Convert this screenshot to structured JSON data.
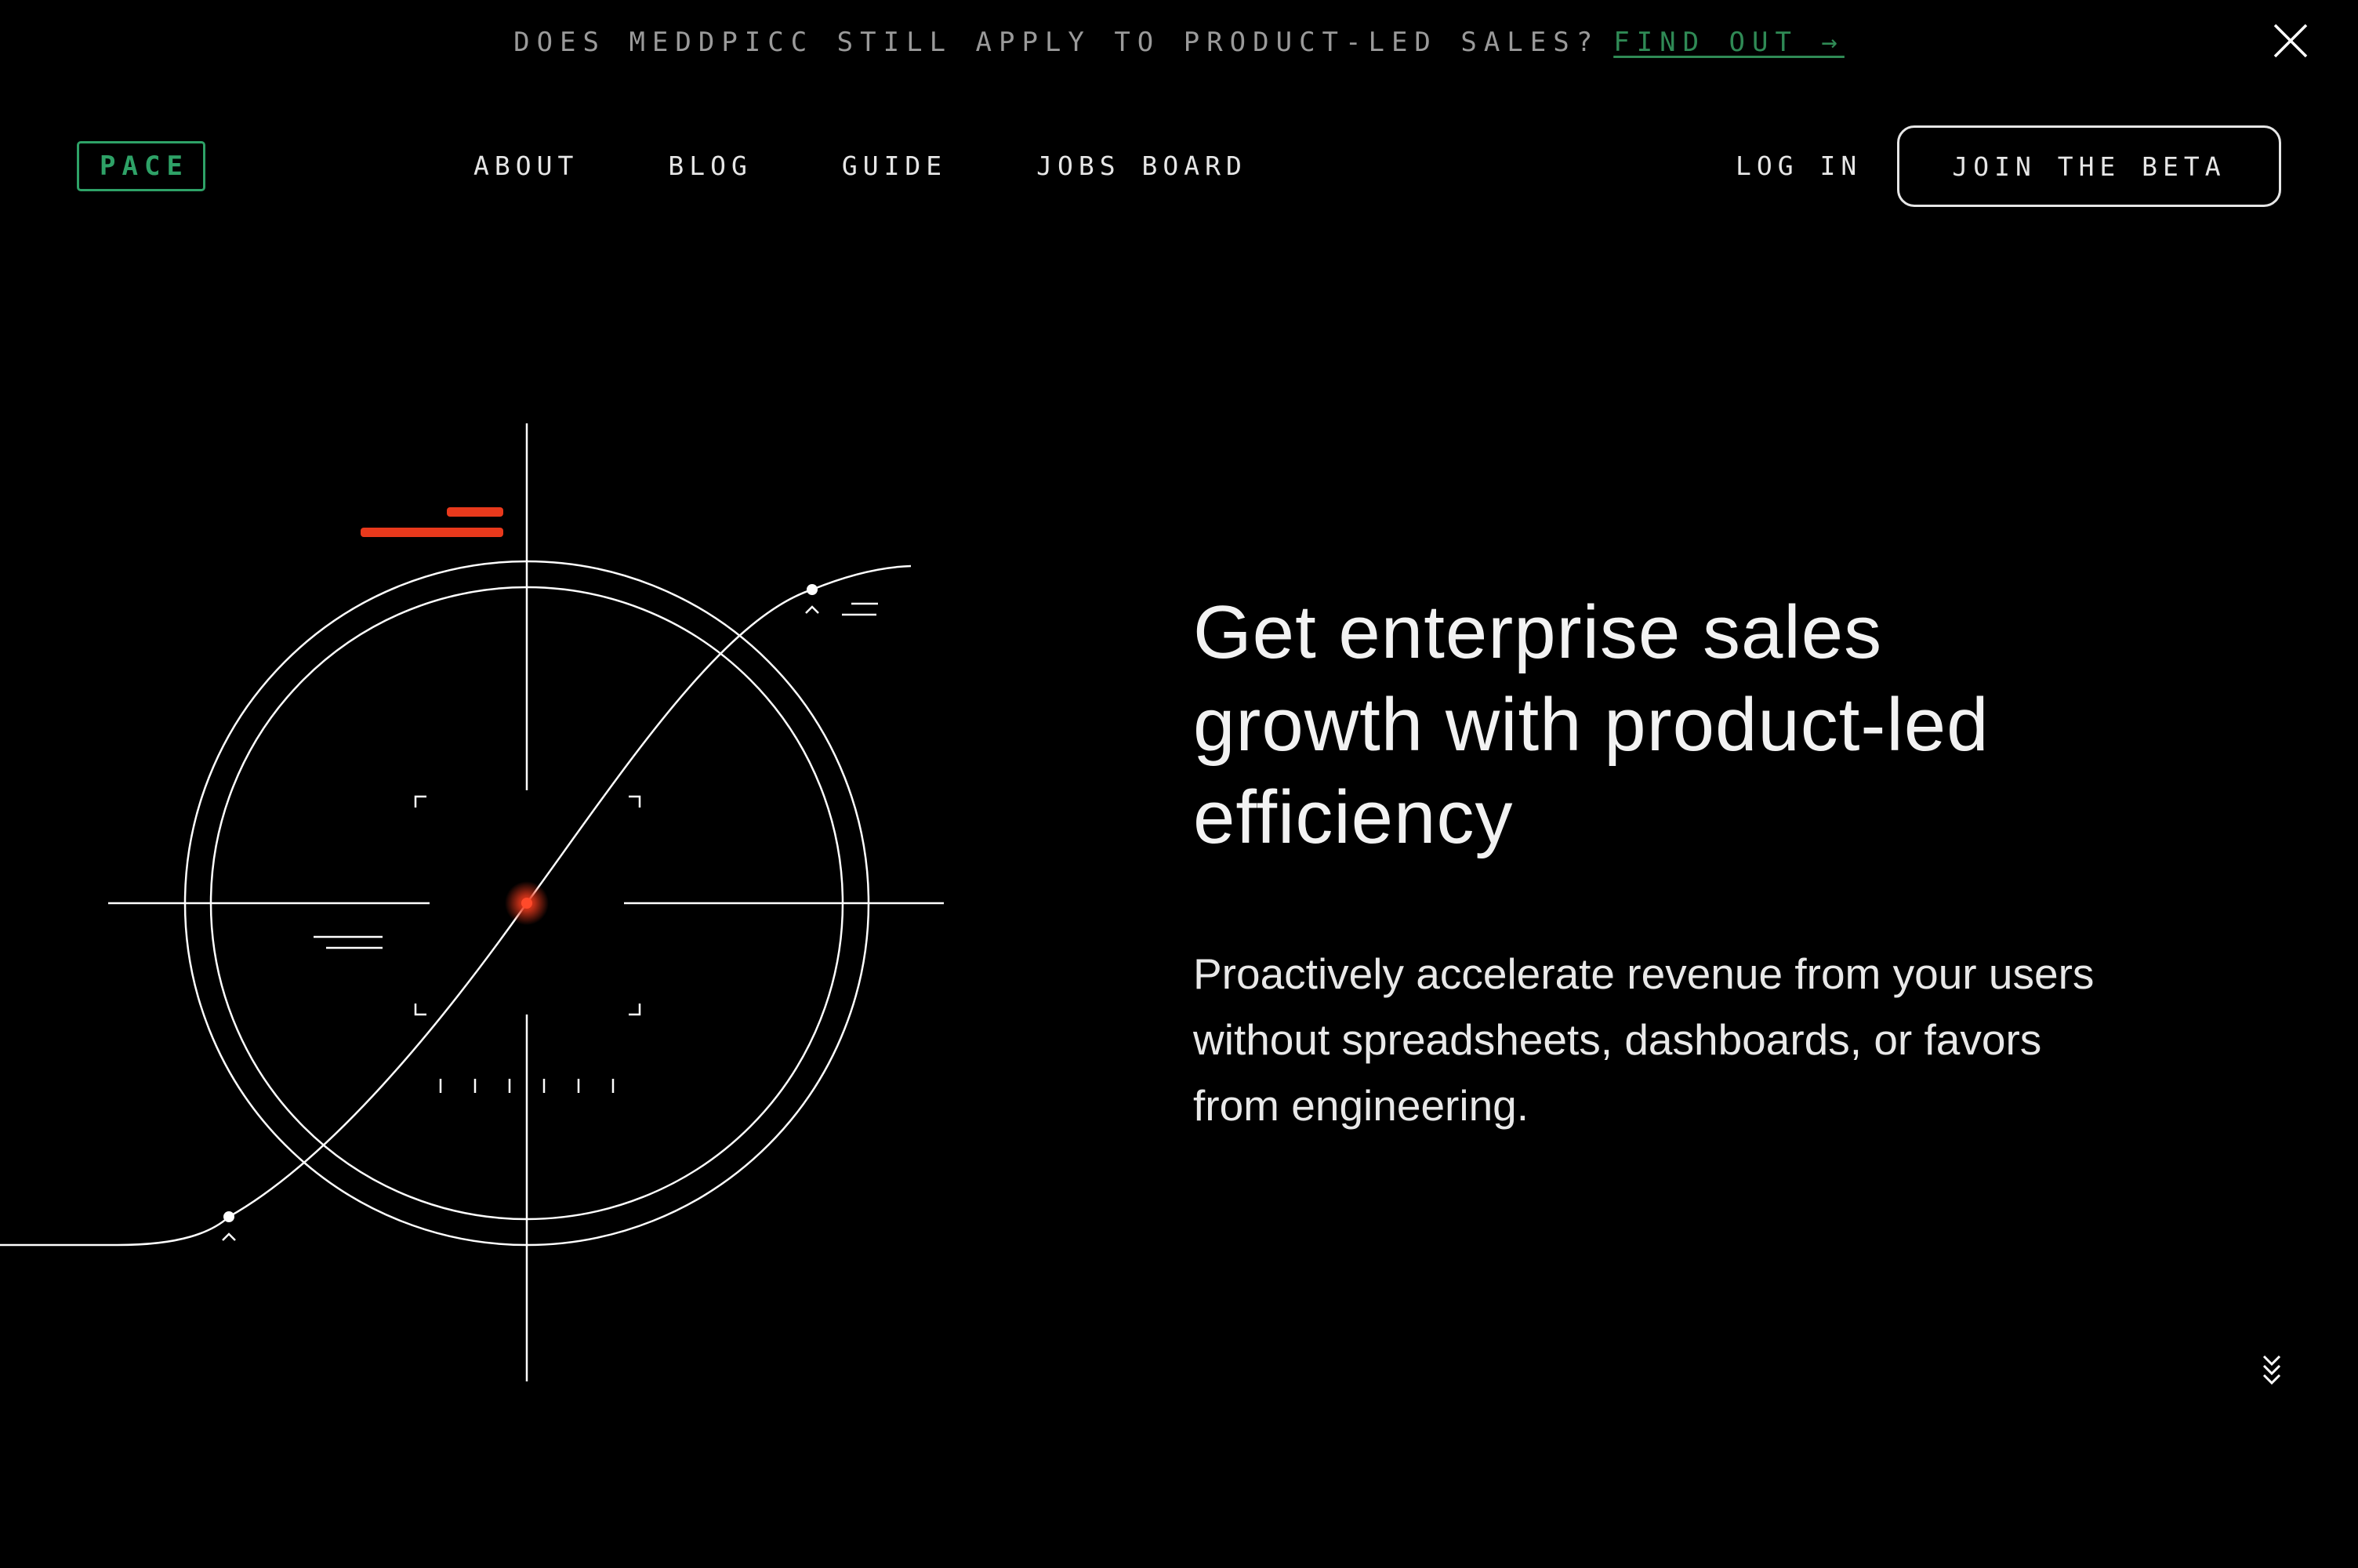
{
  "announcement": {
    "text": "DOES MEDDPICC STILL APPLY TO PRODUCT-LED SALES?",
    "link_label": "FIND OUT →"
  },
  "header": {
    "logo": "PACE",
    "nav": [
      "ABOUT",
      "BLOG",
      "GUIDE",
      "JOBS BOARD"
    ],
    "login": "LOG IN",
    "cta": "JOIN THE BETA"
  },
  "hero": {
    "headline": "Get enterprise sales growth with product-led efficiency",
    "subtext": "Proactively accelerate revenue from your users without spreadsheets, dashboards, or favors from engineering."
  },
  "icons": {
    "close": "close-icon",
    "scroll": "chevrons-down-icon",
    "illustration": "target-reticle-illustration"
  },
  "colors": {
    "background": "#000000",
    "brand_green": "#2ea267",
    "link_green": "#2f8a55",
    "accent_red": "#e8391c",
    "text": "#f2f2f2"
  }
}
